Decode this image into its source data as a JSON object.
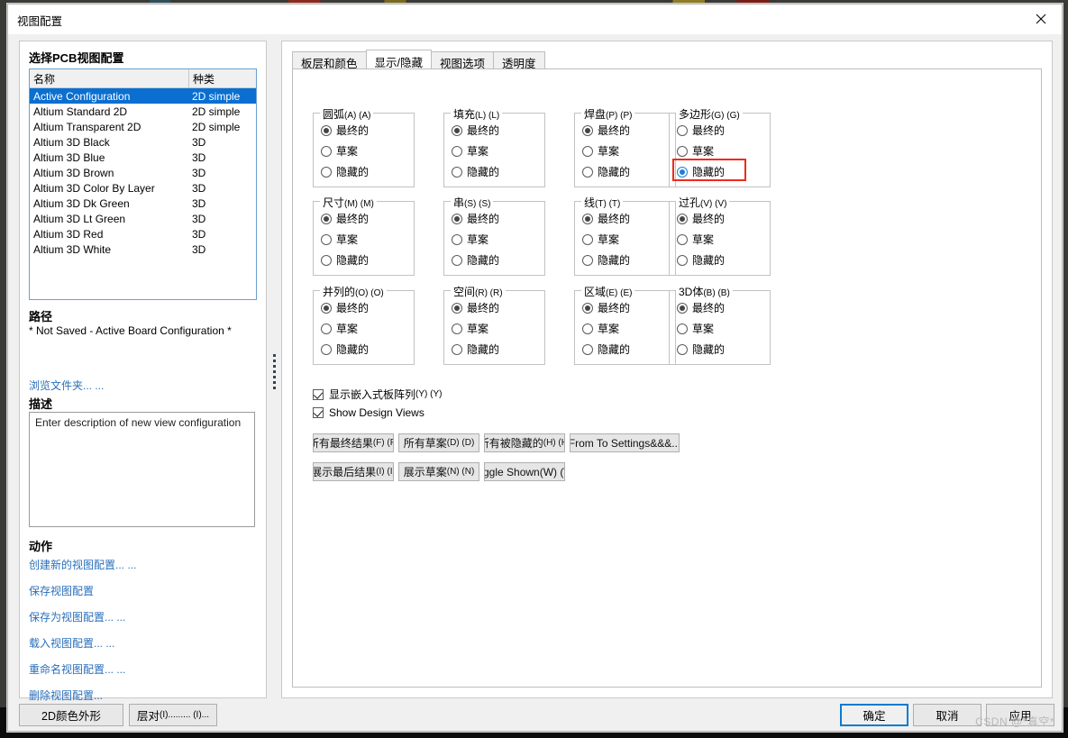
{
  "window": {
    "title": "视图配置",
    "close_icon": "close-icon"
  },
  "left_panel": {
    "title": "选择PCB视图配置",
    "list": {
      "columns": [
        "名称",
        "种类"
      ],
      "rows": [
        {
          "name": "Active Configuration",
          "kind": "2D simple",
          "selected": true
        },
        {
          "name": "Altium Standard 2D",
          "kind": "2D simple",
          "selected": false
        },
        {
          "name": "Altium Transparent 2D",
          "kind": "2D simple",
          "selected": false
        },
        {
          "name": "Altium 3D Black",
          "kind": "3D",
          "selected": false
        },
        {
          "name": "Altium 3D Blue",
          "kind": "3D",
          "selected": false
        },
        {
          "name": "Altium 3D Brown",
          "kind": "3D",
          "selected": false
        },
        {
          "name": "Altium 3D Color By Layer",
          "kind": "3D",
          "selected": false
        },
        {
          "name": "Altium 3D Dk Green",
          "kind": "3D",
          "selected": false
        },
        {
          "name": "Altium 3D Lt Green",
          "kind": "3D",
          "selected": false
        },
        {
          "name": "Altium 3D Red",
          "kind": "3D",
          "selected": false
        },
        {
          "name": "Altium 3D White",
          "kind": "3D",
          "selected": false
        }
      ]
    },
    "path_heading": "路径",
    "path_value": "* Not Saved - Active Board Configuration *",
    "browse_link": "浏览文件夹... ...",
    "description_heading": "描述",
    "description_value": "Enter description of new view configuration",
    "actions_heading": "动作",
    "actions": [
      "创建新的视图配置... ...",
      "保存视图配置",
      "保存为视图配置... ...",
      "载入视图配置... ...",
      "重命名视图配置... ...",
      "删除视图配置..."
    ]
  },
  "tabs": [
    {
      "label": "板层和颜色",
      "active": false
    },
    {
      "label": "显示/隐藏",
      "active": true
    },
    {
      "label": "视图选项",
      "active": false
    },
    {
      "label": "透明度",
      "active": false
    }
  ],
  "options": {
    "radio_labels": [
      "最终的",
      "草案",
      "隐藏的"
    ],
    "groups": [
      {
        "title": "圆弧",
        "mnemonic": "(A) (A)",
        "selected": 0,
        "highlighted": false
      },
      {
        "title": "填充",
        "mnemonic": "(L) (L)",
        "selected": 0,
        "highlighted": false
      },
      {
        "title": "焊盘",
        "mnemonic": "(P) (P)",
        "selected": 0,
        "highlighted": false
      },
      {
        "title": "多边形",
        "mnemonic": "(G) (G)",
        "selected": 2,
        "highlighted": true
      },
      {
        "title": "尺寸",
        "mnemonic": "(M) (M)",
        "selected": 0,
        "highlighted": false
      },
      {
        "title": "串",
        "mnemonic": "(S) (S)",
        "selected": 0,
        "highlighted": false
      },
      {
        "title": "线",
        "mnemonic": "(T) (T)",
        "selected": 0,
        "highlighted": false
      },
      {
        "title": "过孔",
        "mnemonic": "(V) (V)",
        "selected": 0,
        "highlighted": false
      },
      {
        "title": "并列的",
        "mnemonic": "(O) (O)",
        "selected": 0,
        "highlighted": false
      },
      {
        "title": "空间",
        "mnemonic": "(R) (R)",
        "selected": 0,
        "highlighted": false
      },
      {
        "title": "区域",
        "mnemonic": "(E) (E)",
        "selected": 0,
        "highlighted": false
      },
      {
        "title": "3D体",
        "mnemonic": "(B) (B)",
        "selected": 0,
        "highlighted": false
      }
    ]
  },
  "checkboxes": [
    {
      "label": "显示嵌入式板阵列",
      "mnemonic": "(Y) (Y)",
      "checked": true
    },
    {
      "label": "Show Design Views",
      "mnemonic": "",
      "checked": true
    }
  ],
  "action_buttons": [
    {
      "label": "所有最终结果",
      "mnemonic": "(F) (F)"
    },
    {
      "label": "所有草案",
      "mnemonic": "(D) (D)"
    },
    {
      "label": "所有被隐藏的",
      "mnemonic": "(H) (H)"
    },
    {
      "label": "From To Settings&&&...",
      "mnemonic": ""
    },
    {
      "label": "展示最后结果",
      "mnemonic": "(I) (I)"
    },
    {
      "label": "展示草案",
      "mnemonic": "(N) (N)"
    },
    {
      "label": "Toggle Shown(W) (W)",
      "mnemonic": ""
    }
  ],
  "footer": {
    "left_buttons": [
      {
        "label": "2D颜色外形",
        "mnemonic": ""
      },
      {
        "label": "层对",
        "mnemonic": "(I)......... (I)..."
      }
    ],
    "ok": "确定",
    "cancel": "取消",
    "apply": "应用"
  },
  "watermark": "CSDN @*真空*",
  "colors": {
    "accent": "#0a6fd0",
    "link": "#2a6fbb",
    "highlight": "#ef2a1c",
    "radio_selected_blue": "#1c7fd6"
  }
}
